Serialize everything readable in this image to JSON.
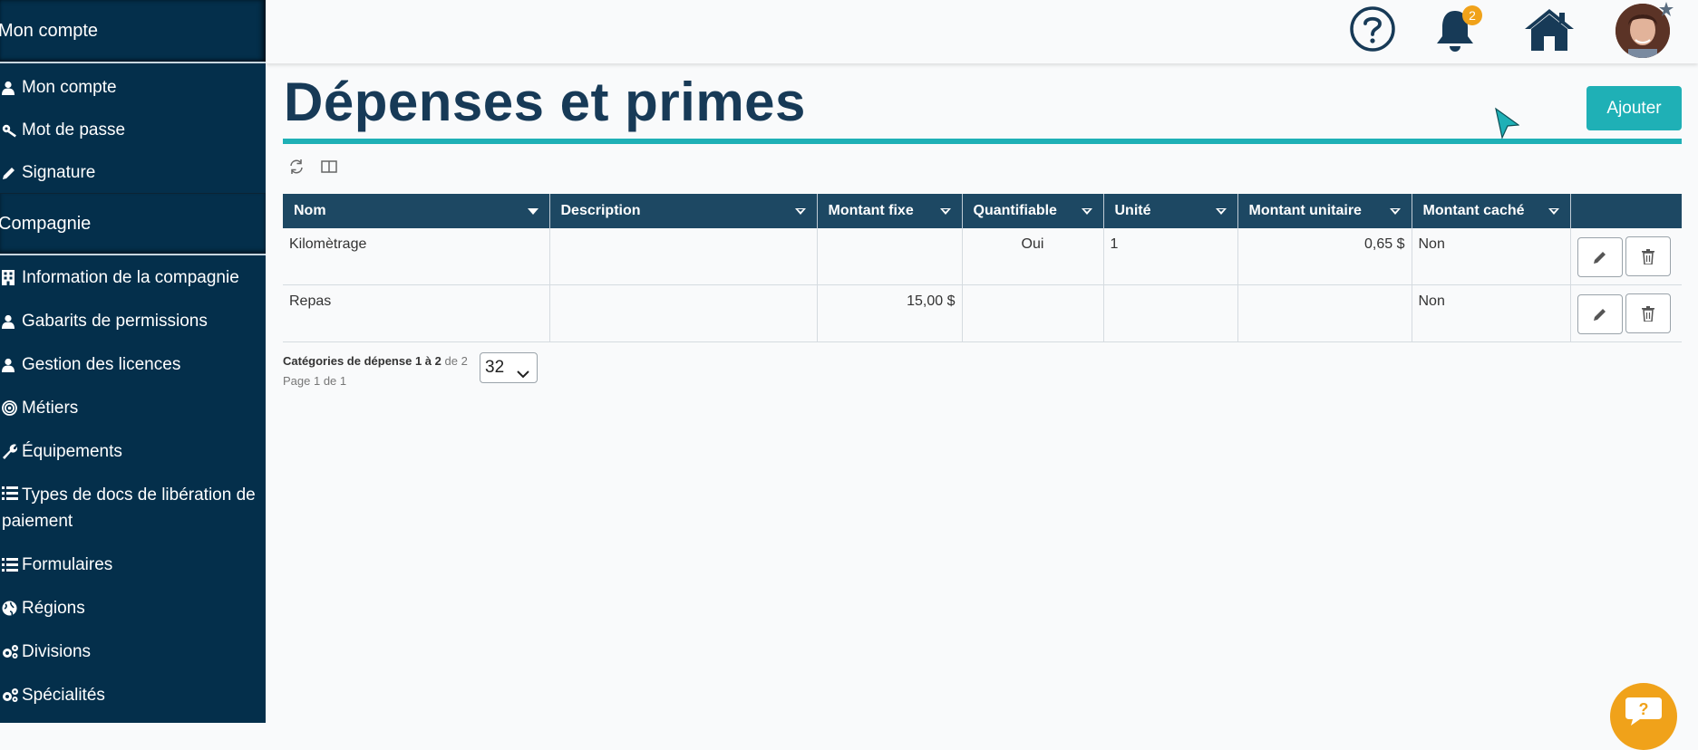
{
  "sidebar": {
    "section_account": "Mon compte",
    "account_items": [
      {
        "label": "Mon compte",
        "icon": "user-icon"
      },
      {
        "label": "Mot de passe",
        "icon": "key-icon"
      },
      {
        "label": "Signature",
        "icon": "pencil-icon"
      }
    ],
    "section_company": "Compagnie",
    "company_items": [
      {
        "label": "Information de la compagnie",
        "icon": "building-icon"
      },
      {
        "label": "Gabarits de permissions",
        "icon": "user-icon"
      },
      {
        "label": "Gestion des licences",
        "icon": "user-icon"
      },
      {
        "label": "Métiers",
        "icon": "target-icon"
      },
      {
        "label": "Équipements",
        "icon": "wrench-icon"
      },
      {
        "label": "Types de docs de libération de paiement",
        "icon": "list-icon"
      },
      {
        "label": "Formulaires",
        "icon": "list-icon"
      },
      {
        "label": "Régions",
        "icon": "globe-icon"
      },
      {
        "label": "Divisions",
        "icon": "cogs-icon"
      },
      {
        "label": "Spécialités",
        "icon": "cogs-icon"
      }
    ]
  },
  "header": {
    "notification_count": "2",
    "icons": [
      "help-icon",
      "bell-icon",
      "home-icon",
      "user-avatar"
    ]
  },
  "page": {
    "title": "Dépenses et primes",
    "add_button": "Ajouter"
  },
  "table": {
    "columns": [
      "Nom",
      "Description",
      "Montant fixe",
      "Quantifiable",
      "Unité",
      "Montant unitaire",
      "Montant caché"
    ],
    "rows": [
      {
        "nom": "Kilomètrage",
        "description": "",
        "montant_fixe": "",
        "quantifiable": "Oui",
        "unite": "1",
        "montant_unitaire": "0,65 $",
        "montant_cache": "Non"
      },
      {
        "nom": "Repas",
        "description": "",
        "montant_fixe": "15,00 $",
        "quantifiable": "",
        "unite": "",
        "montant_unitaire": "",
        "montant_cache": "Non"
      }
    ]
  },
  "pager": {
    "label": "Catégories de dépense",
    "range": "1 à 2",
    "of_total": "de 2",
    "page_text": "Page 1 de 1",
    "page_size": "32"
  },
  "colors": {
    "sidebar_bg": "#042f4b",
    "accent": "#1fb0b6",
    "table_header": "#1d4863",
    "badge": "#f0a21a"
  }
}
